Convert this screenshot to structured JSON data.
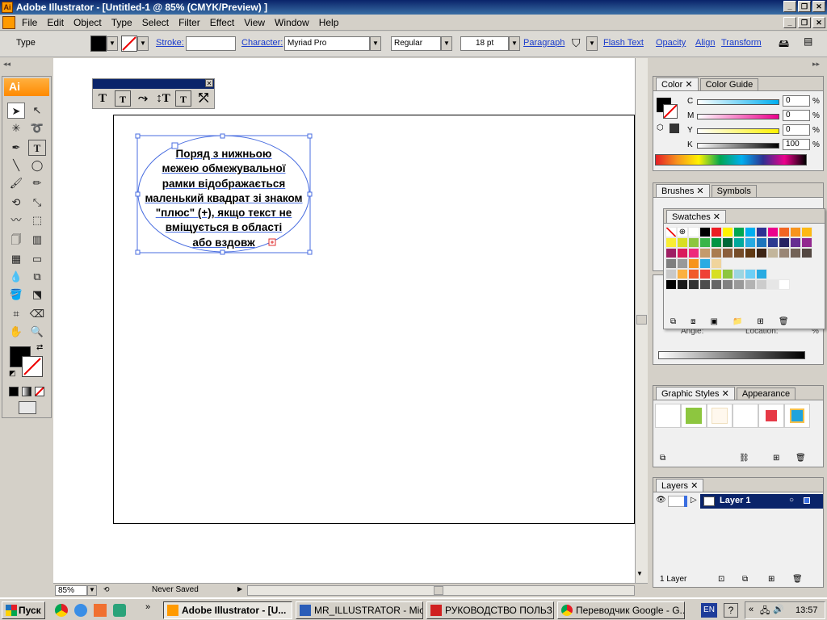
{
  "title": "Adobe Illustrator - [Untitled-1 @ 85% (CMYK/Preview) ]",
  "menu": [
    "File",
    "Edit",
    "Object",
    "Type",
    "Select",
    "Filter",
    "Effect",
    "View",
    "Window",
    "Help"
  ],
  "control": {
    "type_label": "Type",
    "stroke_label": "Stroke:",
    "character_label": "Character:",
    "font_family": "Myriad Pro",
    "font_style": "Regular",
    "font_size": "18 pt",
    "paragraph_label": "Paragraph",
    "flash_text_label": "Flash Text",
    "opacity_label": "Opacity",
    "align_label": "Align",
    "transform_label": "Transform"
  },
  "toolbox": {
    "logo": "Ai"
  },
  "text_frame": {
    "lines": [
      "Поряд з нижньою",
      "межею обмежувальної",
      "рамки відображається",
      "маленький квадрат зі знаком",
      "\"плюс\" (+), якщо текст не",
      "вміщується в області",
      "або вздовж"
    ]
  },
  "status": {
    "zoom": "85%",
    "save_state": "Never Saved"
  },
  "color_panel": {
    "tabs": [
      "Color",
      "Color Guide"
    ],
    "channels": [
      {
        "name": "C",
        "value": "0"
      },
      {
        "name": "M",
        "value": "0"
      },
      {
        "name": "Y",
        "value": "0"
      },
      {
        "name": "K",
        "value": "100"
      }
    ],
    "unit": "%"
  },
  "brushes_panel": {
    "tabs": [
      "Brushes",
      "Symbols"
    ]
  },
  "swatches_panel": {
    "tab": "Swatches"
  },
  "gradient_panel": {
    "angle_label": "Angle:",
    "location_label": "Location:",
    "unit": "%"
  },
  "styles_panel": {
    "tabs": [
      "Graphic Styles",
      "Appearance"
    ]
  },
  "layers_panel": {
    "tab": "Layers",
    "layer_name": "Layer 1",
    "count_label": "1 Layer"
  },
  "taskbar": {
    "start": "Пуск",
    "items": [
      "Adobe Illustrator - [U...",
      "MR_ILLUSTRATOR - Micr...",
      "РУКОВОДСТВО ПОЛЬЗ...",
      "Переводчик Google - G..."
    ],
    "lang": "EN",
    "time": "13:57"
  }
}
